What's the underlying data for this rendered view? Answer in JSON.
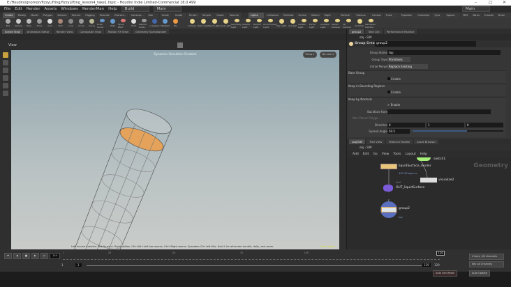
{
  "window": {
    "title": "E:/Houdini/gnomon/fizzyLifting/fizzyLifting_lesson4_take1.hiplc - Houdini Indie Limited-Commercial 18.0.499",
    "min": "–",
    "max": "□",
    "close": "✕"
  },
  "menu": {
    "items": [
      "File",
      "Edit",
      "Render",
      "Assets",
      "Windows",
      "RenderMan",
      "Help"
    ],
    "desktop": "Build",
    "main": "Main",
    "main_right": "Main"
  },
  "shelf_tabs_left": [
    "Create",
    "Modify",
    "Model",
    "Polygon",
    "Deform",
    "Texture",
    "Rigging",
    "Muscles",
    "Charact...",
    "Constrai...",
    "Hair Utils",
    "Guide P...",
    "Guide B...",
    "Terrain ...",
    "Simple FX",
    "Cloud FX",
    "Volume"
  ],
  "shelf_tabs_right": [
    "Lights and...",
    "Collisions",
    "Particles",
    "Grains",
    "Vellum",
    "Rigid Bodies",
    "Particle Fl...",
    "Viscous Fl...",
    "Oceans",
    "Fluid Con...",
    "Populate C...",
    "Container ...",
    "Pyro FX",
    "Sparse Pyr...",
    "FEM",
    "Wires",
    "Crowds",
    "Drive Sim..."
  ],
  "shelf_tools_left": [
    "Box",
    "Sphere",
    "Tube",
    "Torus",
    "Grid",
    "Null",
    "Line",
    "Circle",
    "Curve",
    "Draw Curve",
    "Path",
    "Spray Paint",
    "Font",
    "Platonic Solids",
    "L-System",
    "Metaball",
    "File"
  ],
  "shelf_tools_right": [
    "Camera",
    "Point Light",
    "Spot Light",
    "Area Light",
    "Geometry Light",
    "Volume Light",
    "Distant Light",
    "Environment Light",
    "Sky Light",
    "GI Light",
    "Caustic Light",
    "Portal Light",
    "Ambient Light",
    "Stereo Camera",
    "VR Camera",
    "Switcher",
    "Gamepad Camera"
  ],
  "left_pane_tabs": [
    "Scene View",
    "Animation Editor",
    "Render View",
    "Composite View",
    "Motion FX View",
    "Geometry Spreadsheet"
  ],
  "viewport": {
    "title": "View",
    "status": "Dynamics Simulation Disabled",
    "persp": "Persp ▾",
    "cam": "No cam ▾",
    "hint": "Left mouse tumbles. Middle pans. Right dollies. Ctrl+Alt+Left box zooms. Ctrl+Right zooms. Spacebar-Ctrl-Left tilts. Hold L for alternate tumble, dolly, and zoom.",
    "badge": "New Object"
  },
  "param_pane": {
    "tabs": [
      "group2",
      "Take List",
      "Performance Monitor"
    ],
    "path": [
      "obj",
      "SIM"
    ],
    "node_type": "Group Create",
    "node_name": "group2",
    "group_name_label": "Group Name",
    "group_name": "top",
    "group_type_label": "Group Type",
    "group_type": "Primitives",
    "initial_merge_label": "Initial Merge",
    "initial_merge": "Replace Existing",
    "base_group": "Base Group",
    "keep_bounding": "Keep in Bounding Regions",
    "keep_normals": "Keep by Normals",
    "enable": "Enable",
    "backface_label": "Backface from",
    "nonplanar_label": "Non-Planar Polygo...",
    "direction_label": "Direction",
    "direction": [
      "0",
      "1",
      "0"
    ],
    "spread_label": "Spread Angle",
    "spread": "50.5",
    "spread_fraction": 0.6
  },
  "network_pane": {
    "tabs": [
      "/obj/SIM",
      "Tree View",
      "Material Palette",
      "Asset Browser"
    ],
    "path": [
      "obj",
      "SIM"
    ],
    "menu": [
      "Add",
      "Edit",
      "Go",
      "View",
      "Tools",
      "Layout",
      "Help"
    ],
    "context": "Geometry",
    "nodes": {
      "switch": "switch1",
      "filecache": "liquidSurface_render",
      "filecache_type": "File Cache",
      "filecache_info": "$OS.$F.bgeo.sc",
      "visualize": "visualize2",
      "null_type": "Null",
      "out": "OUT_liquidSurface",
      "group": "group2",
      "group_info": "top"
    }
  },
  "timeline": {
    "ticks": [
      "1",
      "25",
      "50",
      "75",
      "100"
    ],
    "current": "129",
    "frame": "129",
    "start1": "1",
    "start2": "1",
    "end1": "129",
    "end2": "129",
    "keys": "0 keys, 0/0 channels",
    "key_all": "Key All Channels",
    "auto_update": "Auto Update",
    "sim": "Auto Sim Reset"
  }
}
